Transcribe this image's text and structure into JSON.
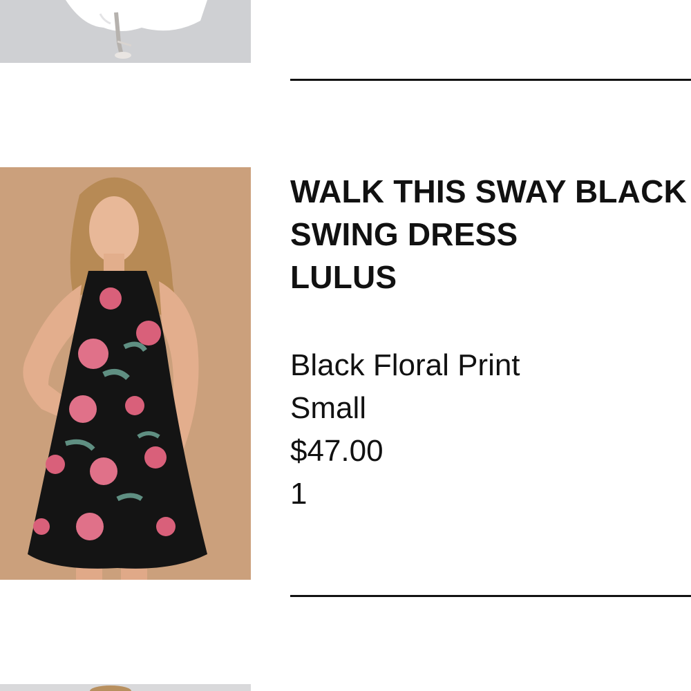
{
  "previous_item": {
    "image_alt": "model in white dress and silver heels"
  },
  "item": {
    "name_line1": "WALK THIS SWAY BLACK",
    "name_line2": "SWING DRESS",
    "brand": "LULUS",
    "color": "Black Floral Print",
    "size": "Small",
    "price": "$47.00",
    "quantity": "1",
    "image_alt": "model wearing black floral print swing dress"
  },
  "colors": {
    "dress": "#141414",
    "floral": "#d9607a",
    "leaf": "#5f8f82",
    "background": "#c99e79",
    "text": "#111111"
  }
}
